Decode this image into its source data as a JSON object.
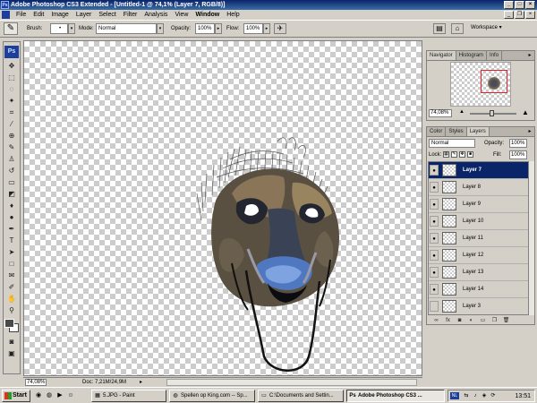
{
  "window": {
    "title": "Adobe Photoshop CS3 Extended - [Untitled-1 @ 74,1% (Layer 7, RGB/8)]",
    "app_icon": "Ps"
  },
  "menu": [
    "File",
    "Edit",
    "Image",
    "Layer",
    "Select",
    "Filter",
    "Analysis",
    "View",
    "Window",
    "Help"
  ],
  "options": {
    "brush_label": "Brush:",
    "mode_label": "Mode:",
    "mode_value": "Normal",
    "opacity_label": "Opacity:",
    "opacity_value": "100%",
    "flow_label": "Flow:",
    "flow_value": "100%",
    "workspace_label": "Workspace ▾"
  },
  "tools_logo": "Ps",
  "status": {
    "zoom": "74,08%",
    "doc": "Doc: 7,21M/24,9M"
  },
  "navigator": {
    "tabs": [
      "Navigator",
      "Histogram",
      "Info"
    ],
    "zoom": "74,08%"
  },
  "layers_panel": {
    "tabs": [
      "Color",
      "Styles",
      "Layers"
    ],
    "blend_mode": "Normal",
    "opacity_label": "Opacity:",
    "opacity_value": "100%",
    "lock_label": "Lock:",
    "fill_label": "Fill:",
    "fill_value": "100%",
    "layers": [
      {
        "name": "Layer 7",
        "selected": true
      },
      {
        "name": "Layer 8",
        "selected": false
      },
      {
        "name": "Layer 9",
        "selected": false
      },
      {
        "name": "Layer 10",
        "selected": false
      },
      {
        "name": "Layer 11",
        "selected": false
      },
      {
        "name": "Layer 12",
        "selected": false
      },
      {
        "name": "Layer 13",
        "selected": false
      },
      {
        "name": "Layer 14",
        "selected": false
      },
      {
        "name": "Layer 3",
        "selected": false
      }
    ]
  },
  "taskbar": {
    "start": "Start",
    "tasks": [
      {
        "label": "5.JPG - Paint",
        "active": false
      },
      {
        "label": "Spellen op King.com -- Sp...",
        "active": false
      },
      {
        "label": "C:\\Documents and Settin...",
        "active": false
      },
      {
        "label": "Adobe Photoshop CS3 ...",
        "active": true
      }
    ],
    "lang": "NL",
    "clock": "13:51"
  },
  "colors": {
    "title_bar": "#0a246a",
    "selected_layer": "#0a246a",
    "navigator_view_box": "#e0202a",
    "foreground_swatch": "#4a4a4a",
    "background_swatch": "#ffffff"
  }
}
